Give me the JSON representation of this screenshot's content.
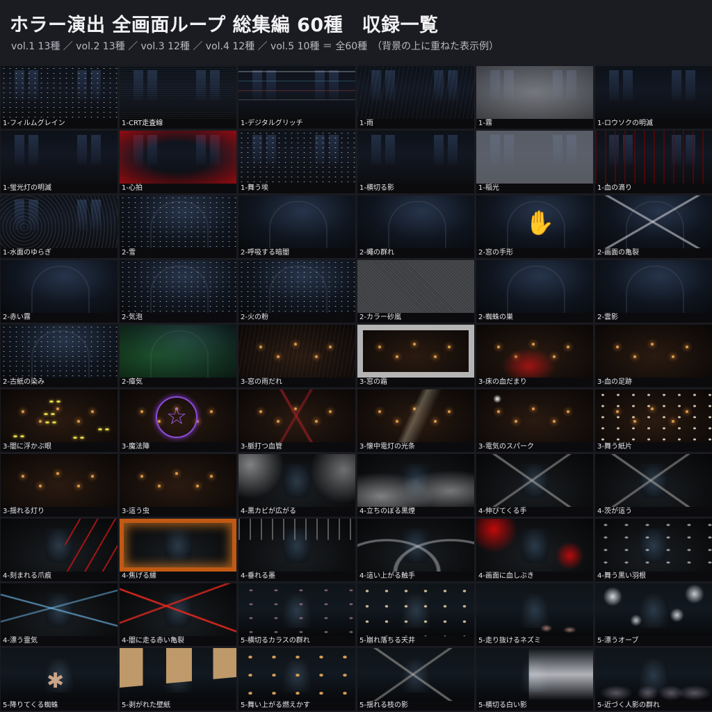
{
  "header": {
    "title": "ホラー演出 全画面ループ 総集編 60種　収録一覧",
    "subtitle": "vol.1 13種 ／ vol.2 13種 ／ vol.3 12種 ／ vol.4 12種 ／ vol.5 10種 ＝ 全60種　（背景の上に重ねた表示例）"
  },
  "effects": [
    "1-フィルムグレイン",
    "1-CRT走査線",
    "1-デジタルグリッチ",
    "1-雨",
    "1-霧",
    "1-ロウソクの明滅",
    "1-蛍光灯の明滅",
    "1-心拍",
    "1-舞う埃",
    "1-横切る影",
    "1-稲光",
    "1-血の滴り",
    "1-水面のゆらぎ",
    "2-雪",
    "2-呼吸する暗闇",
    "2-蠅の群れ",
    "2-窓の手形",
    "2-画面の亀裂",
    "2-赤い霧",
    "2-気泡",
    "2-火の粉",
    "2-カラー砂嵐",
    "2-蜘蛛の巣",
    "2-雲影",
    "2-古紙の染み",
    "2-瘴気",
    "3-窓の雨だれ",
    "3-窓の霜",
    "3-床の血だまり",
    "3-血の足跡",
    "3-闇に浮かぶ眼",
    "3-魔法陣",
    "3-脈打つ血管",
    "3-懐中電灯の光条",
    "3-電気のスパーク",
    "3-舞う紙片",
    "3-揺れる灯り",
    "3-這う虫",
    "4-黒カビが広がる",
    "4-立ちのぼる黒煙",
    "4-伸びてくる手",
    "4-茨が這う",
    "4-刻まれる爪痕",
    "4-焦げる縁",
    "4-垂れる墨",
    "4-這い上がる触手",
    "4-画面に血しぶき",
    "4-舞う黒い羽根",
    "4-漂う霊気",
    "4-闇に走る赤い亀裂",
    "5-横切るカラスの群れ",
    "5-崩れ落ちる天井",
    "5-走り抜けるネズミ",
    "5-漂うオーブ",
    "5-降りてくる蜘蛛",
    "5-剥がれた壁紙",
    "5-舞い上がる燃えかす",
    "5-揺れる枝の影",
    "5-横切る白い影",
    "5-近づく人影の群れ"
  ]
}
